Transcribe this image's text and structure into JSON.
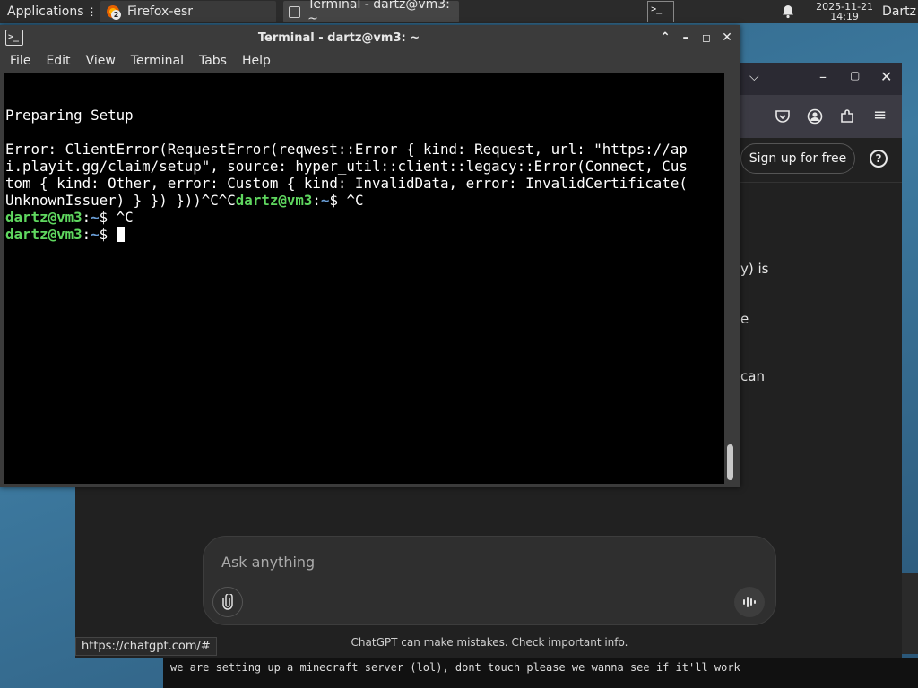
{
  "panel": {
    "apps_label": "Applications",
    "apps_overflow": "⋮",
    "firefox_badge": "2",
    "firefox_label": "Firefox-esr",
    "terminal_task_label": "Terminal - dartz@vm3: ~",
    "clock_date": "2025-11-21",
    "clock_time": "14:19",
    "user": "Dartz"
  },
  "terminal": {
    "title": "Terminal - dartz@vm3: ~",
    "menu": [
      "File",
      "Edit",
      "View",
      "Terminal",
      "Tabs",
      "Help"
    ],
    "heading": "Preparing Setup",
    "error_lines": [
      "Error: ClientError(RequestError(reqwest::Error { kind: Request, url: \"https://ap",
      "i.playit.gg/claim/setup\", source: hyper_util::client::legacy::Error(Connect, Cus",
      "tom { kind: Other, error: Custom { kind: InvalidData, error: InvalidCertificate(",
      "UnknownIssuer) } }) }))^C^C"
    ],
    "prompt_user": "dartz@vm3",
    "prompt_sep": ":",
    "prompt_path": "~",
    "prompt_symbol": "$",
    "cmd1": "^C",
    "cmd2": "^C"
  },
  "browser": {
    "signup_label": "Sign up for free",
    "help_symbol": "?",
    "fragment_1": "y) is",
    "fragment_2": "e",
    "fragment_3": "can",
    "composer_placeholder": "Ask anything",
    "disclaimer": "ChatGPT can make mistakes. Check important info.",
    "status_url": "https://chatgpt.com/#"
  },
  "bottom_note": "we are setting up a minecraft server (lol), dont touch please we wanna see if it'll work"
}
